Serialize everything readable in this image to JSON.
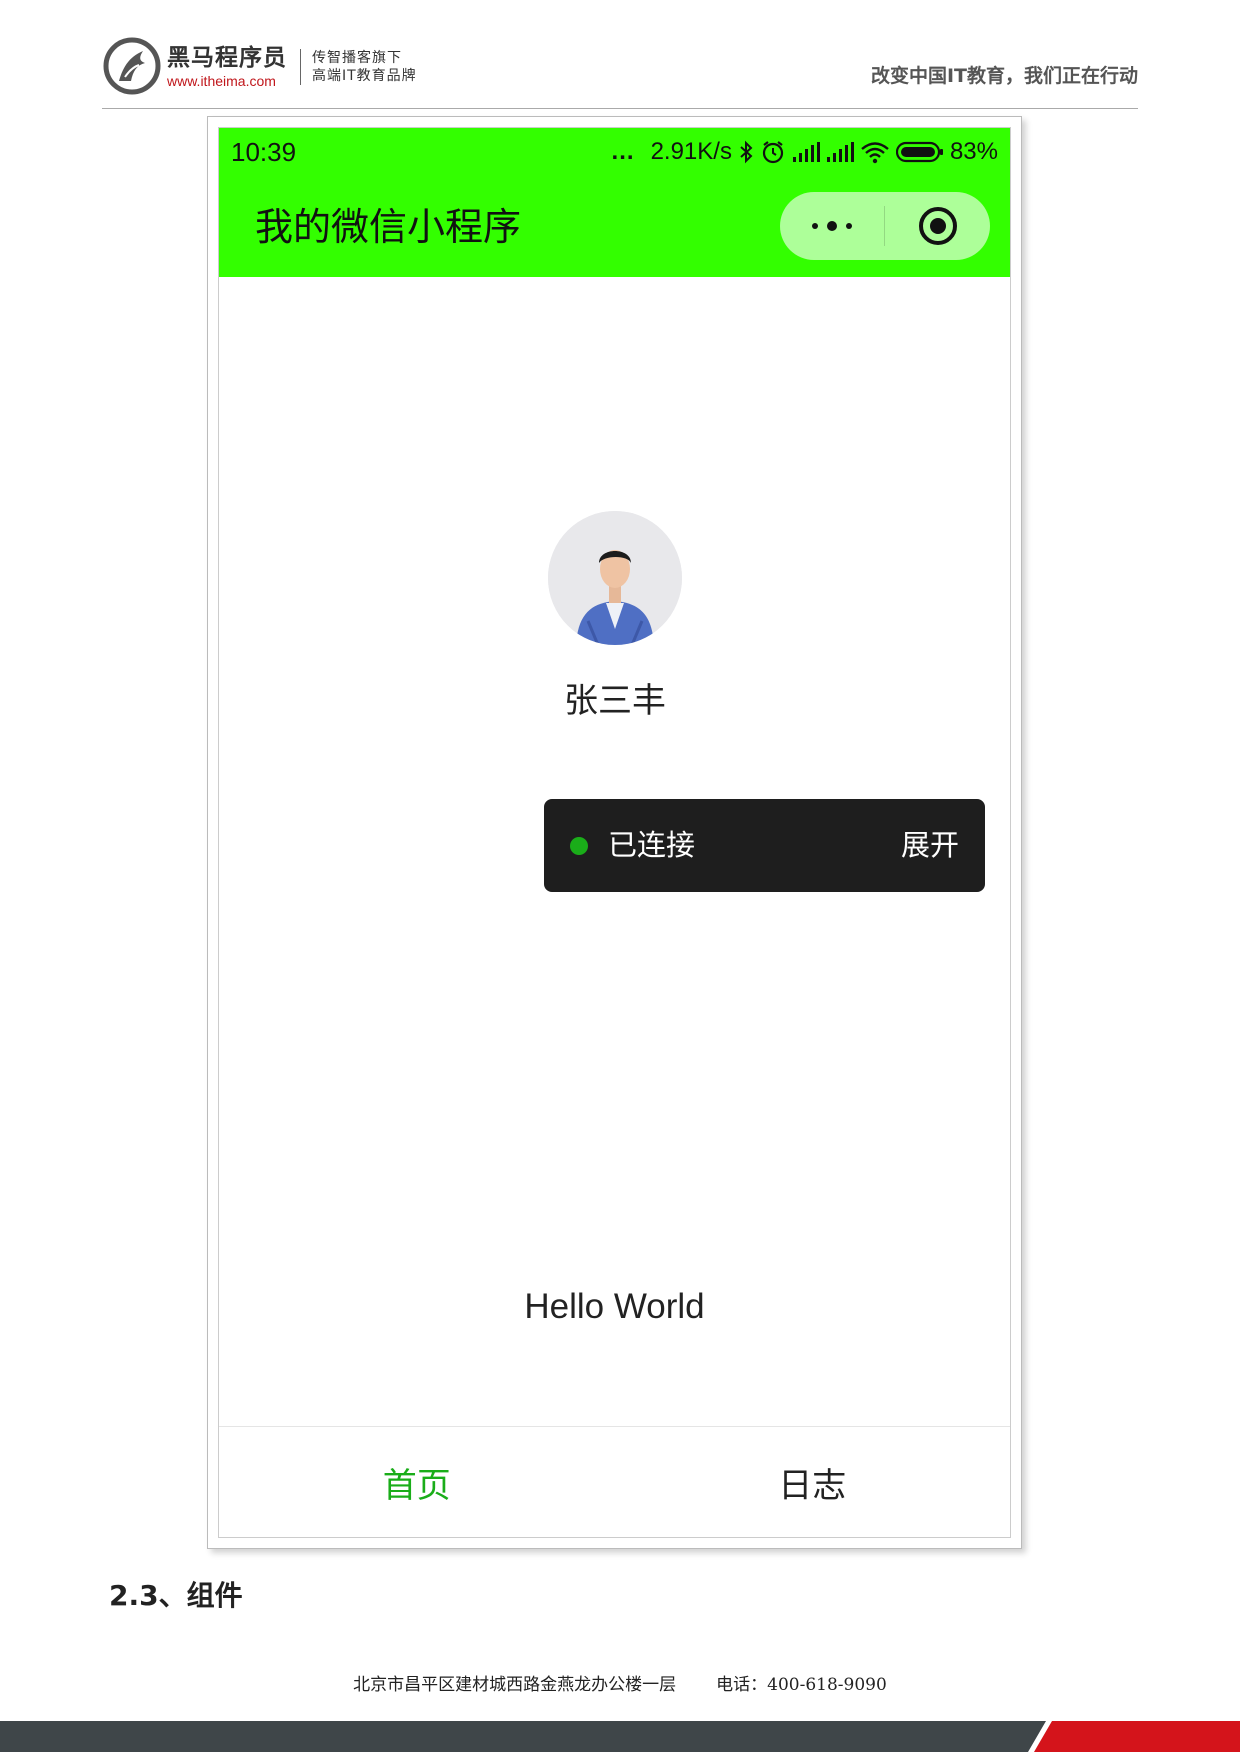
{
  "header": {
    "brand_name": "黑马程序员",
    "brand_url": "www.itheima.com",
    "slogan_line1": "传智播客旗下",
    "slogan_line2": "高端IT教育品牌",
    "motto": "改变中国IT教育，我们正在行动"
  },
  "phone": {
    "status_bar": {
      "time": "10:39",
      "more": "...",
      "speed": "2.91K/s",
      "battery": "83%",
      "icons": [
        "bluetooth-icon",
        "alarm-icon",
        "signal-icon",
        "signal-icon",
        "wifi-icon",
        "battery-icon"
      ]
    },
    "nav_title": "我的微信小程序",
    "capsule_icons": [
      "more-icon",
      "close-target-icon"
    ],
    "user": {
      "avatar": "avatar-photo",
      "name": "张三丰"
    },
    "toast": {
      "status": "已连接",
      "action": "展开",
      "dot_color": "#1aad19"
    },
    "hello_text": "Hello World",
    "tabs": [
      {
        "label": "首页",
        "active": true,
        "color": "#1aad19"
      },
      {
        "label": "日志",
        "active": false,
        "color": "#222222"
      }
    ],
    "navbar_color": "#33ff00"
  },
  "section_heading": "2.3、组件",
  "footer": {
    "address": "北京市昌平区建材城西路金燕龙办公楼一层",
    "phone_label": "电话：400-618-9090"
  }
}
